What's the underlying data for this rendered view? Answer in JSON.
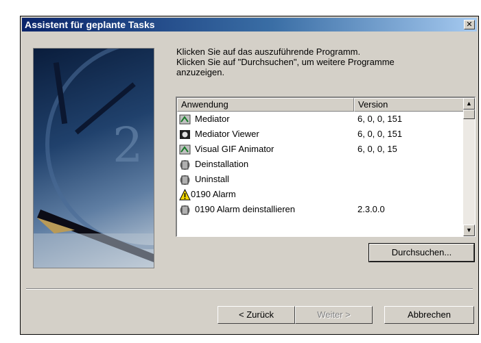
{
  "window": {
    "title": "Assistent für geplante Tasks"
  },
  "instructions": {
    "line1": "Klicken Sie auf das auszuführende Programm.",
    "line2": "Klicken Sie auf \"Durchsuchen\", um weitere Programme",
    "line3": "anzuzeigen."
  },
  "list": {
    "columns": [
      "Anwendung",
      "Version"
    ],
    "rows": [
      {
        "name": "Mediator",
        "version": "6, 0, 0, 151",
        "icon": "mediator-icon"
      },
      {
        "name": "Mediator Viewer",
        "version": "6, 0, 0, 151",
        "icon": "mediator-viewer-icon"
      },
      {
        "name": "Visual GIF Animator",
        "version": "6, 0, 0, 15",
        "icon": "gif-animator-icon"
      },
      {
        "name": "Deinstallation",
        "version": "",
        "icon": "uninstall-icon"
      },
      {
        "name": "Uninstall",
        "version": "",
        "icon": "uninstall-icon"
      },
      {
        "name": "0190 Alarm",
        "version": "",
        "icon": "warning-icon"
      },
      {
        "name": "0190 Alarm deinstallieren",
        "version": "2.3.0.0",
        "icon": "uninstall-icon"
      }
    ]
  },
  "buttons": {
    "browse": "Durchsuchen...",
    "back": "< Zurück",
    "next": "Weiter >",
    "cancel": "Abbrechen"
  },
  "colors": {
    "title_start": "#0a246a",
    "title_end": "#a6caf0",
    "face": "#d4d0c8"
  }
}
